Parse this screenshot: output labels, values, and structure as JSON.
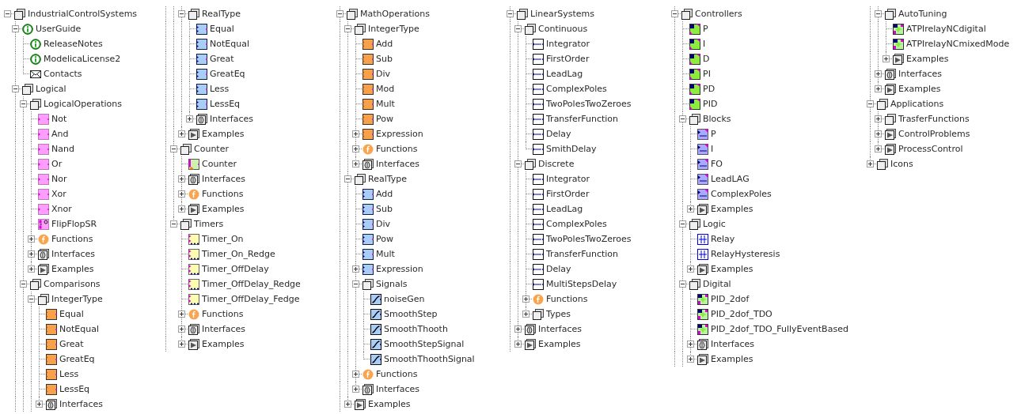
{
  "tree": [
    {
      "label": "IndustrialControlSystems",
      "kind": "package",
      "expanded": true,
      "children": [
        {
          "label": "UserGuide",
          "kind": "info",
          "expanded": true,
          "children": [
            {
              "label": "ReleaseNotes",
              "kind": "info"
            },
            {
              "label": "ModelicaLicense2",
              "kind": "info"
            },
            {
              "label": "Contacts",
              "kind": "mail"
            }
          ]
        },
        {
          "label": "Logical",
          "kind": "package",
          "expanded": true,
          "children": [
            {
              "label": "LogicalOperations",
              "kind": "package",
              "expanded": true,
              "children": [
                {
                  "label": "Not",
                  "kind": "logic"
                },
                {
                  "label": "And",
                  "kind": "logic"
                },
                {
                  "label": "Nand",
                  "kind": "logic"
                },
                {
                  "label": "Or",
                  "kind": "logic"
                },
                {
                  "label": "Nor",
                  "kind": "logic"
                },
                {
                  "label": "Xor",
                  "kind": "logic"
                },
                {
                  "label": "Xnor",
                  "kind": "logic"
                },
                {
                  "label": "FlipFlopSR",
                  "kind": "flipflop"
                },
                {
                  "label": "Functions",
                  "kind": "function",
                  "expanded": false
                },
                {
                  "label": "Interfaces",
                  "kind": "interfaces",
                  "expanded": false
                },
                {
                  "label": "Examples",
                  "kind": "examples",
                  "expanded": false
                }
              ]
            },
            {
              "label": "Comparisons",
              "kind": "package",
              "expanded": true,
              "children": [
                {
                  "label": "IntegerType",
                  "kind": "package",
                  "expanded": true,
                  "children": [
                    {
                      "label": "Equal",
                      "kind": "int"
                    },
                    {
                      "label": "NotEqual",
                      "kind": "int"
                    },
                    {
                      "label": "Great",
                      "kind": "int"
                    },
                    {
                      "label": "GreatEq",
                      "kind": "int"
                    },
                    {
                      "label": "Less",
                      "kind": "int"
                    },
                    {
                      "label": "LessEq",
                      "kind": "int"
                    },
                    {
                      "label": "Interfaces",
                      "kind": "interfaces",
                      "expanded": false
                    }
                  ]
                },
                {
                  "label": "RealType",
                  "kind": "package",
                  "expanded": true,
                  "children": [
                    {
                      "label": "Equal",
                      "kind": "real"
                    },
                    {
                      "label": "NotEqual",
                      "kind": "real"
                    },
                    {
                      "label": "Great",
                      "kind": "real"
                    },
                    {
                      "label": "GreatEq",
                      "kind": "real"
                    },
                    {
                      "label": "Less",
                      "kind": "real"
                    },
                    {
                      "label": "LessEq",
                      "kind": "real"
                    },
                    {
                      "label": "Interfaces",
                      "kind": "interfaces",
                      "expanded": false
                    }
                  ]
                },
                {
                  "label": "Examples",
                  "kind": "examples",
                  "expanded": false
                }
              ]
            },
            {
              "label": "Counter",
              "kind": "package",
              "expanded": true,
              "children": [
                {
                  "label": "Counter",
                  "kind": "counter"
                },
                {
                  "label": "Interfaces",
                  "kind": "interfaces",
                  "expanded": false
                },
                {
                  "label": "Functions",
                  "kind": "function",
                  "expanded": false
                },
                {
                  "label": "Examples",
                  "kind": "examples",
                  "expanded": false
                }
              ]
            },
            {
              "label": "Timers",
              "kind": "package",
              "expanded": true,
              "children": [
                {
                  "label": "Timer_On",
                  "kind": "timer"
                },
                {
                  "label": "Timer_On_Redge",
                  "kind": "timer"
                },
                {
                  "label": "Timer_OffDelay",
                  "kind": "timer"
                },
                {
                  "label": "Timer_OffDelay_Redge",
                  "kind": "timer"
                },
                {
                  "label": "Timer_OffDelay_Fedge",
                  "kind": "timer"
                },
                {
                  "label": "Functions",
                  "kind": "function",
                  "expanded": false
                },
                {
                  "label": "Interfaces",
                  "kind": "interfaces",
                  "expanded": false
                },
                {
                  "label": "Examples",
                  "kind": "examples",
                  "expanded": false
                }
              ]
            }
          ]
        },
        {
          "label": "MathOperations",
          "kind": "package",
          "expanded": true,
          "children": [
            {
              "label": "IntegerType",
              "kind": "package",
              "expanded": true,
              "children": [
                {
                  "label": "Add",
                  "kind": "int"
                },
                {
                  "label": "Sub",
                  "kind": "int"
                },
                {
                  "label": "Div",
                  "kind": "int"
                },
                {
                  "label": "Mod",
                  "kind": "int"
                },
                {
                  "label": "Mult",
                  "kind": "int"
                },
                {
                  "label": "Pow",
                  "kind": "int"
                },
                {
                  "label": "Expression",
                  "kind": "int",
                  "expanded": false
                },
                {
                  "label": "Functions",
                  "kind": "function",
                  "expanded": false
                },
                {
                  "label": "Interfaces",
                  "kind": "interfaces",
                  "expanded": false
                }
              ]
            },
            {
              "label": "RealType",
              "kind": "package",
              "expanded": true,
              "children": [
                {
                  "label": "Add",
                  "kind": "real"
                },
                {
                  "label": "Sub",
                  "kind": "real"
                },
                {
                  "label": "Div",
                  "kind": "real"
                },
                {
                  "label": "Pow",
                  "kind": "real"
                },
                {
                  "label": "Mult",
                  "kind": "real"
                },
                {
                  "label": "Expression",
                  "kind": "real",
                  "expanded": false
                },
                {
                  "label": "Signals",
                  "kind": "package",
                  "expanded": true,
                  "children": [
                    {
                      "label": "noiseGen",
                      "kind": "signal"
                    },
                    {
                      "label": "SmoothStep",
                      "kind": "signal"
                    },
                    {
                      "label": "SmoothThooth",
                      "kind": "signal"
                    },
                    {
                      "label": "SmoothStepSignal",
                      "kind": "signal"
                    },
                    {
                      "label": "SmoothThoothSignal",
                      "kind": "signal"
                    }
                  ]
                },
                {
                  "label": "Functions",
                  "kind": "function",
                  "expanded": false
                },
                {
                  "label": "Interfaces",
                  "kind": "interfaces",
                  "expanded": false
                }
              ]
            },
            {
              "label": "Examples",
              "kind": "examples",
              "expanded": false
            }
          ]
        },
        {
          "label": "LinearSystems",
          "kind": "package",
          "expanded": true,
          "children": [
            {
              "label": "Continuous",
              "kind": "package",
              "expanded": true,
              "children": [
                {
                  "label": "Integrator",
                  "kind": "linear"
                },
                {
                  "label": "FirstOrder",
                  "kind": "linear"
                },
                {
                  "label": "LeadLag",
                  "kind": "linear"
                },
                {
                  "label": "ComplexPoles",
                  "kind": "linear"
                },
                {
                  "label": "TwoPolesTwoZeroes",
                  "kind": "linear"
                },
                {
                  "label": "TransferFunction",
                  "kind": "linear"
                },
                {
                  "label": "Delay",
                  "kind": "linear"
                },
                {
                  "label": "SmithDelay",
                  "kind": "linear"
                }
              ]
            },
            {
              "label": "Discrete",
              "kind": "package",
              "expanded": true,
              "children": [
                {
                  "label": "Integrator",
                  "kind": "linear"
                },
                {
                  "label": "FirstOrder",
                  "kind": "linear"
                },
                {
                  "label": "LeadLag",
                  "kind": "linear"
                },
                {
                  "label": "ComplexPoles",
                  "kind": "linear"
                },
                {
                  "label": "TwoPolesTwoZeroes",
                  "kind": "linear"
                },
                {
                  "label": "TransferFunction",
                  "kind": "linear"
                },
                {
                  "label": "Delay",
                  "kind": "linear"
                },
                {
                  "label": "MultiStepsDelay",
                  "kind": "linear"
                },
                {
                  "label": "Functions",
                  "kind": "function",
                  "expanded": false
                },
                {
                  "label": "Types",
                  "kind": "package",
                  "expanded": false
                }
              ]
            },
            {
              "label": "Interfaces",
              "kind": "interfaces",
              "expanded": false
            },
            {
              "label": "Examples",
              "kind": "examples",
              "expanded": false
            }
          ]
        },
        {
          "label": "Controllers",
          "kind": "package",
          "expanded": true,
          "children": [
            {
              "label": "P",
              "kind": "controller"
            },
            {
              "label": "I",
              "kind": "controller"
            },
            {
              "label": "D",
              "kind": "controller"
            },
            {
              "label": "PI",
              "kind": "controller"
            },
            {
              "label": "PD",
              "kind": "controller"
            },
            {
              "label": "PID",
              "kind": "controller"
            },
            {
              "label": "Blocks",
              "kind": "package",
              "expanded": true,
              "children": [
                {
                  "label": "P",
                  "kind": "pidblock"
                },
                {
                  "label": "I",
                  "kind": "pidblock"
                },
                {
                  "label": "FO",
                  "kind": "pidblock"
                },
                {
                  "label": "LeadLAG",
                  "kind": "pidblock"
                },
                {
                  "label": "ComplexPoles",
                  "kind": "pidblock"
                },
                {
                  "label": "Examples",
                  "kind": "examples",
                  "expanded": false
                }
              ]
            },
            {
              "label": "Logic",
              "kind": "package",
              "expanded": true,
              "children": [
                {
                  "label": "Relay",
                  "kind": "relay"
                },
                {
                  "label": "RelayHysteresis",
                  "kind": "relay"
                },
                {
                  "label": "Examples",
                  "kind": "examples",
                  "expanded": false
                }
              ]
            },
            {
              "label": "Digital",
              "kind": "package",
              "expanded": true,
              "children": [
                {
                  "label": "PID_2dof",
                  "kind": "digital"
                },
                {
                  "label": "PID_2dof_TDO",
                  "kind": "digital"
                },
                {
                  "label": "PID_2dof_TDO_FullyEventBased",
                  "kind": "digital"
                },
                {
                  "label": "Interfaces",
                  "kind": "interfaces",
                  "expanded": false
                },
                {
                  "label": "Examples",
                  "kind": "examples",
                  "expanded": false
                }
              ]
            },
            {
              "label": "AutoTuning",
              "kind": "package",
              "expanded": true,
              "children": [
                {
                  "label": "ATPIrelayNCdigital",
                  "kind": "digital"
                },
                {
                  "label": "ATPIrelayNCmixedMode",
                  "kind": "digital"
                },
                {
                  "label": "Examples",
                  "kind": "examples",
                  "expanded": false
                }
              ]
            },
            {
              "label": "Interfaces",
              "kind": "interfaces",
              "expanded": false
            },
            {
              "label": "Examples",
              "kind": "examples",
              "expanded": false
            }
          ]
        },
        {
          "label": "Applications",
          "kind": "package",
          "expanded": true,
          "children": [
            {
              "label": "TrasferFunctions",
              "kind": "package",
              "expanded": false
            },
            {
              "label": "ControlProblems",
              "kind": "examples",
              "expanded": false
            },
            {
              "label": "ProcessControl",
              "kind": "examples",
              "expanded": false
            }
          ]
        },
        {
          "label": "Icons",
          "kind": "package",
          "expanded": false
        }
      ]
    }
  ]
}
